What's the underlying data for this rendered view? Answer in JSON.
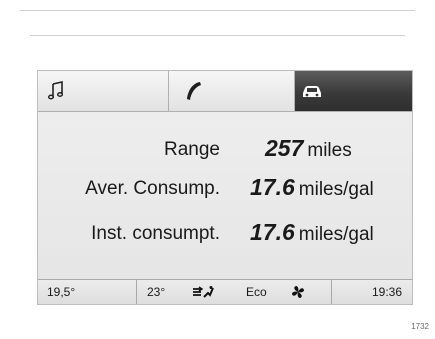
{
  "tabs": [
    {
      "icon": "music-note-icon",
      "active": false
    },
    {
      "icon": "phone-icon",
      "active": false
    },
    {
      "icon": "car-icon",
      "active": true
    }
  ],
  "trip": {
    "range": {
      "label": "Range",
      "value": "257",
      "unit": "miles"
    },
    "avg_consumption": {
      "label": "Aver. Consump.",
      "value": "17.6",
      "unit": "miles/gal"
    },
    "inst_consumption": {
      "label": "Inst. consumpt.",
      "value": "17.6",
      "unit": "miles/gal"
    }
  },
  "status_bar": {
    "temp_left": "19,5°",
    "temp_right": "23°",
    "air_distribution_icon": "air-distribution-icon",
    "mode": "Eco",
    "fan_icon": "fan-icon",
    "clock": "19:36"
  },
  "figure_id": "1732",
  "colors": {
    "active_tab": "#3a3a3a",
    "screen_bg": "#ececec",
    "text": "#1a1a1a"
  }
}
